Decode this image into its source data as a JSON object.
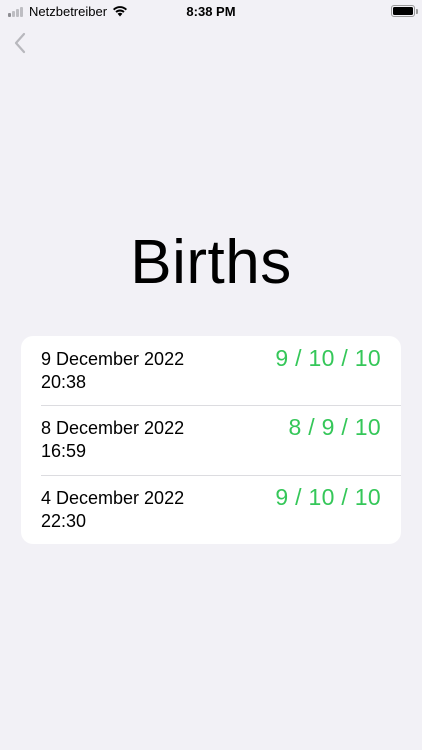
{
  "status_bar": {
    "carrier": "Netzbetreiber",
    "time": "8:38 PM",
    "signal_icon": "signal-bars-icon",
    "wifi_icon": "wifi-icon",
    "battery_icon": "battery-icon",
    "battery_level": 1.0
  },
  "nav": {
    "back_icon": "chevron-left-icon"
  },
  "page": {
    "title": "Births"
  },
  "births": [
    {
      "date": "9 December 2022",
      "time": "20:38",
      "score": "9 / 10 / 10"
    },
    {
      "date": "8 December 2022",
      "time": "16:59",
      "score": "8 / 9 / 10"
    },
    {
      "date": "4 December 2022",
      "time": "22:30",
      "score": "9 / 10 / 10"
    }
  ],
  "colors": {
    "background": "#f2f1f6",
    "card": "#ffffff",
    "score_green": "#35c759",
    "back_chevron": "#b8b8bd"
  }
}
